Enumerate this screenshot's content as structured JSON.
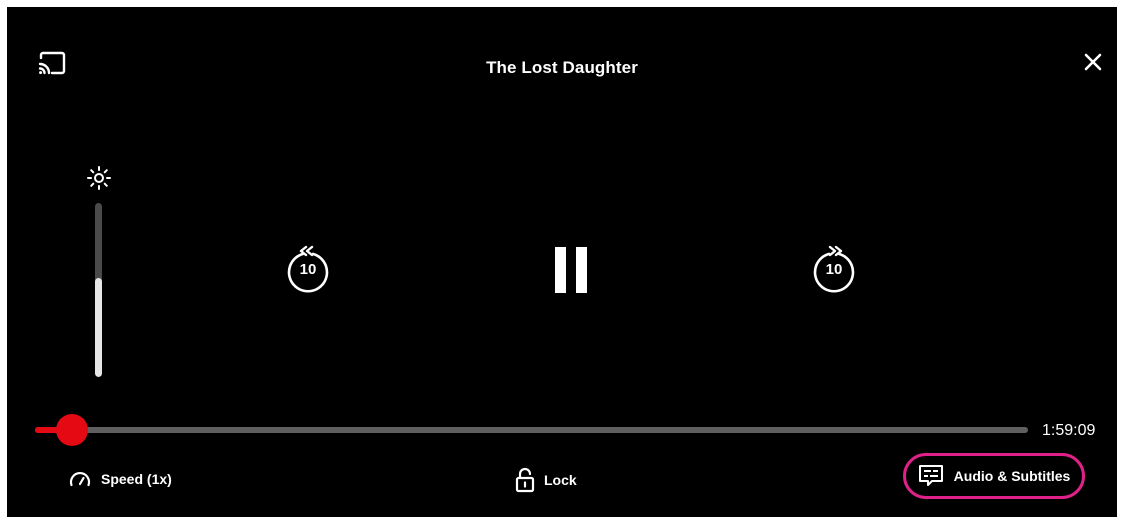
{
  "header": {
    "title": "The Lost Daughter",
    "cast_icon": "cast-icon",
    "close_icon": "close-icon"
  },
  "brightness": {
    "icon": "brightness-icon",
    "level": 0.57
  },
  "controls": {
    "rewind_seconds": "10",
    "forward_seconds": "10",
    "play_state": "pause"
  },
  "progress": {
    "played_fraction": 0.037,
    "time_remaining": "1:59:09"
  },
  "bottom_bar": {
    "speed_label": "Speed (1x)",
    "lock_label": "Lock",
    "audio_subtitles_label": "Audio & Subtitles"
  },
  "colors": {
    "accent": "#e50914",
    "highlight_ring": "#e0218a",
    "background": "#000000"
  }
}
